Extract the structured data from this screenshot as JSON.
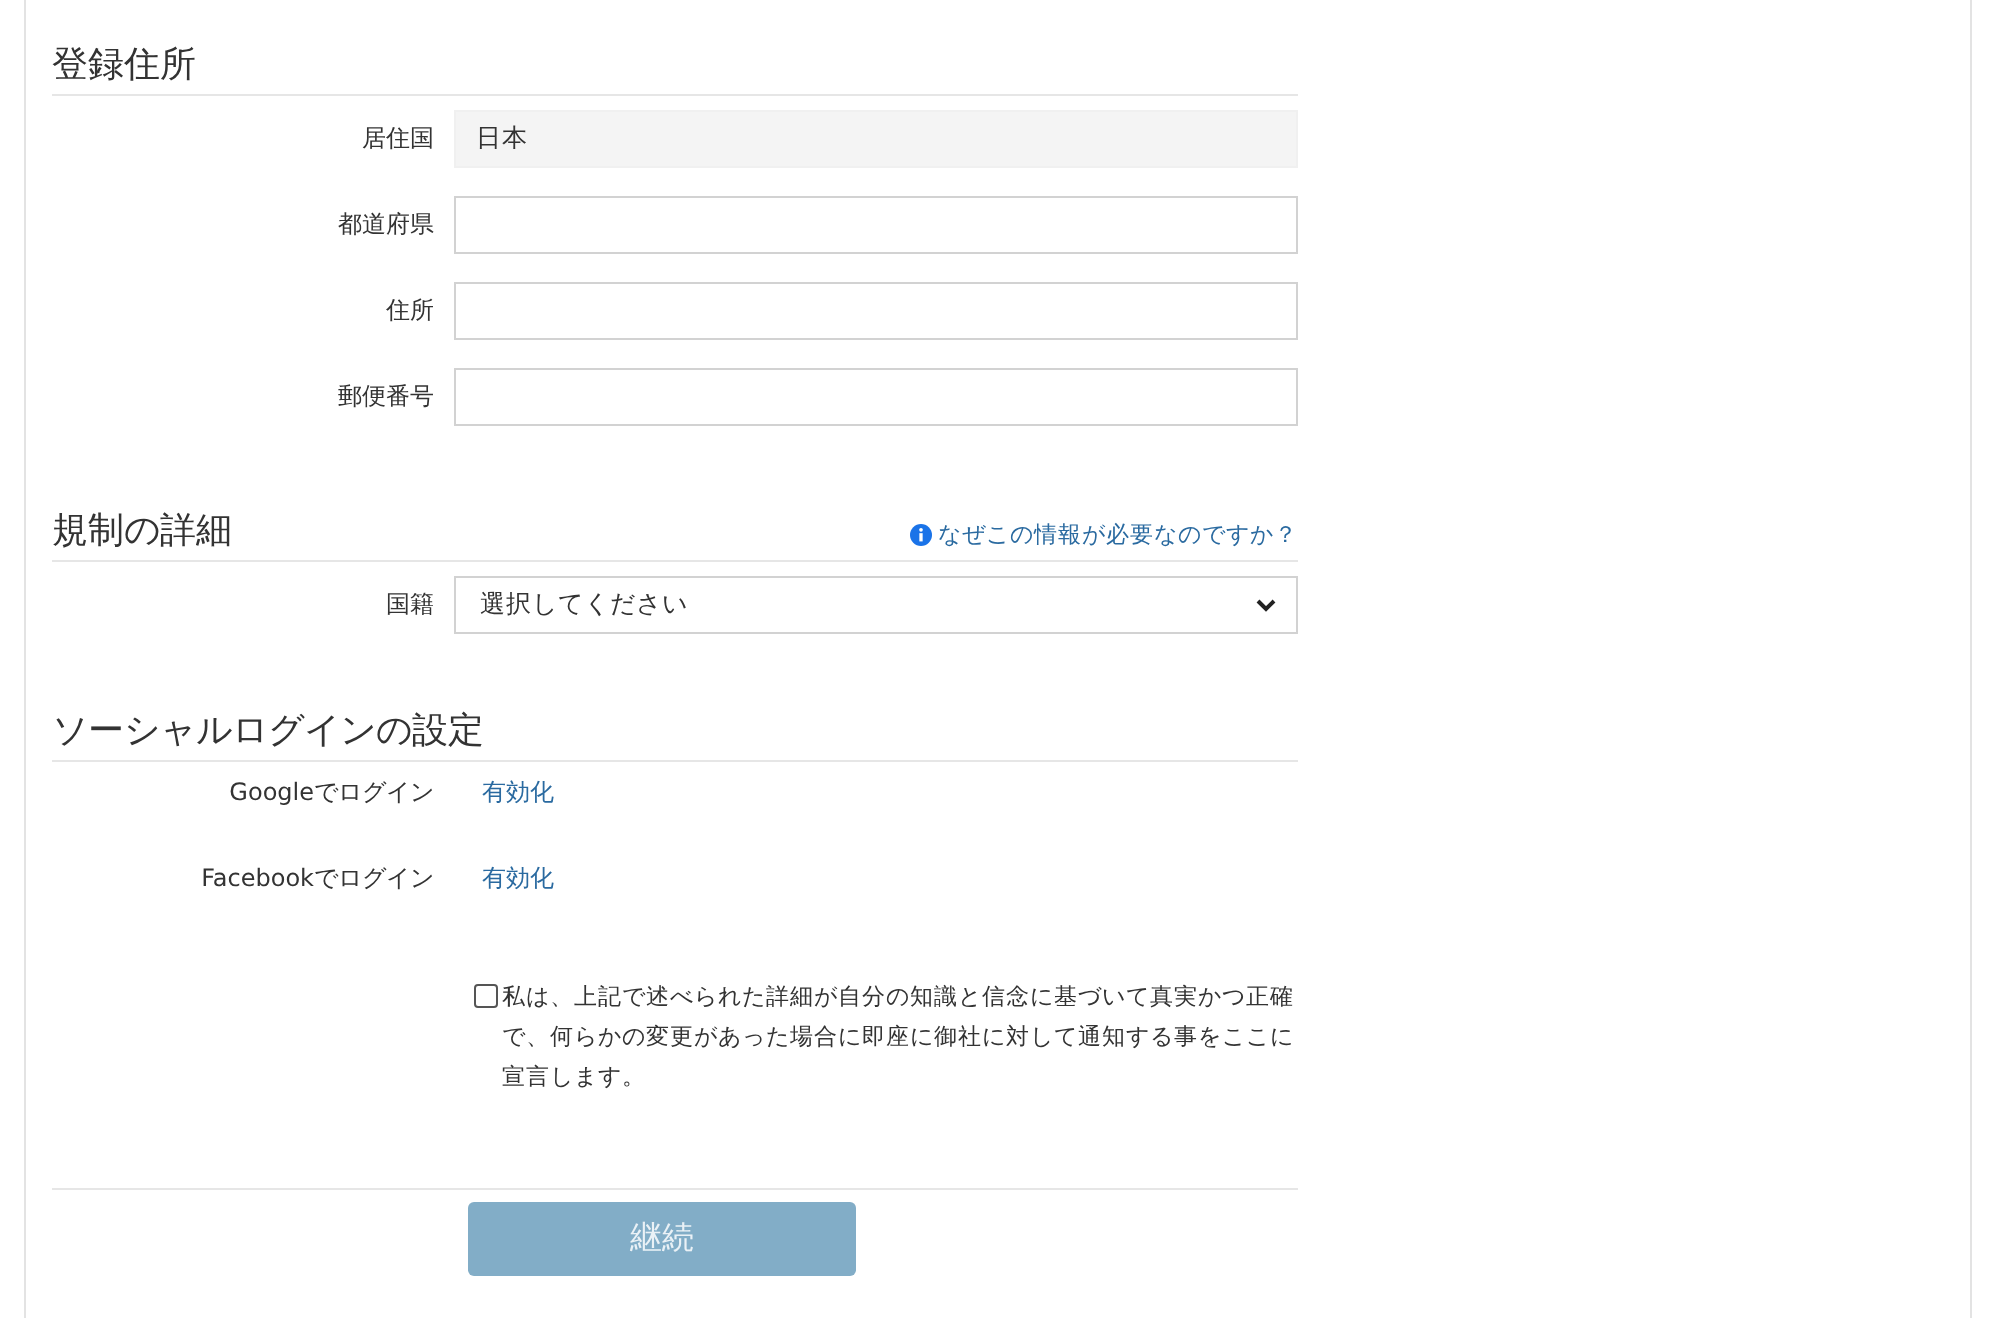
{
  "sections": [
    {
      "title": "登録住所",
      "fields": [
        {
          "kind": "text",
          "label": "居住国",
          "value": "日本",
          "disabled": true
        },
        {
          "kind": "text",
          "label": "都道府県",
          "disabled": false
        },
        {
          "kind": "text",
          "label": "住所",
          "disabled": false
        },
        {
          "kind": "text",
          "label": "郵便番号",
          "disabled": false
        }
      ]
    },
    {
      "title": "規制の詳細",
      "help_link": "なぜこの情報が必要なのですか？",
      "fields": [
        {
          "kind": "select",
          "label": "国籍",
          "value": "選択してください"
        }
      ]
    },
    {
      "title": "ソーシャルログインの設定",
      "fields": [
        {
          "kind": "link",
          "label": "Googleでログイン",
          "value": "有効化"
        },
        {
          "kind": "link",
          "label": "Facebookでログイン",
          "value": "有効化"
        }
      ]
    }
  ],
  "declaration": {
    "checked": false,
    "text": "私は、上記で述べられた詳細が自分の知識と信念に基づいて真実かつ正確で、何らかの変更があった場合に即座に御社に対して通知する事をここに宣言します。"
  },
  "continue_button": {
    "label": "継続",
    "disabled": true
  }
}
